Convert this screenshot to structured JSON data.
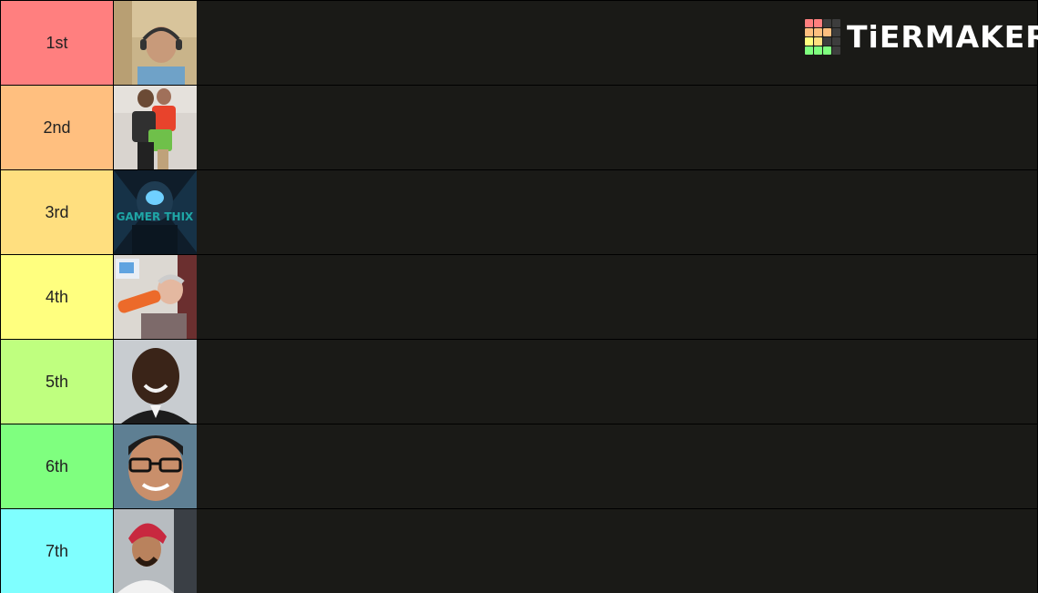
{
  "logo": {
    "text": "TiERMAKER",
    "grid_colors": [
      "#ff7f7f",
      "#ff7f7f",
      "#3d3d3d",
      "#3d3d3d",
      "#ffbf7f",
      "#ffbf7f",
      "#ffbf7f",
      "#3d3d3d",
      "#ffff7f",
      "#ffdf7f",
      "#3d3d3d",
      "#3d3d3d",
      "#7fff7f",
      "#7fff7f",
      "#7fff7f",
      "#3d3d3d"
    ]
  },
  "tiers": [
    {
      "label": "1st",
      "color": "#ff7f7f",
      "image": "person-with-headset-webcam"
    },
    {
      "label": "2nd",
      "color": "#ffbf7f",
      "image": "two-kids-hugging"
    },
    {
      "label": "3rd",
      "color": "#ffdf7f",
      "image": "gamer-thumbnail",
      "image_text": "GAMER THIX"
    },
    {
      "label": "4th",
      "color": "#ffff7f",
      "image": "person-drinking-bottle"
    },
    {
      "label": "5th",
      "color": "#bfff7f",
      "image": "smiling-man-portrait"
    },
    {
      "label": "6th",
      "color": "#7fff7f",
      "image": "man-with-glasses-portrait"
    },
    {
      "label": "7th",
      "color": "#7fffff",
      "image": "man-with-turban-portrait"
    }
  ]
}
